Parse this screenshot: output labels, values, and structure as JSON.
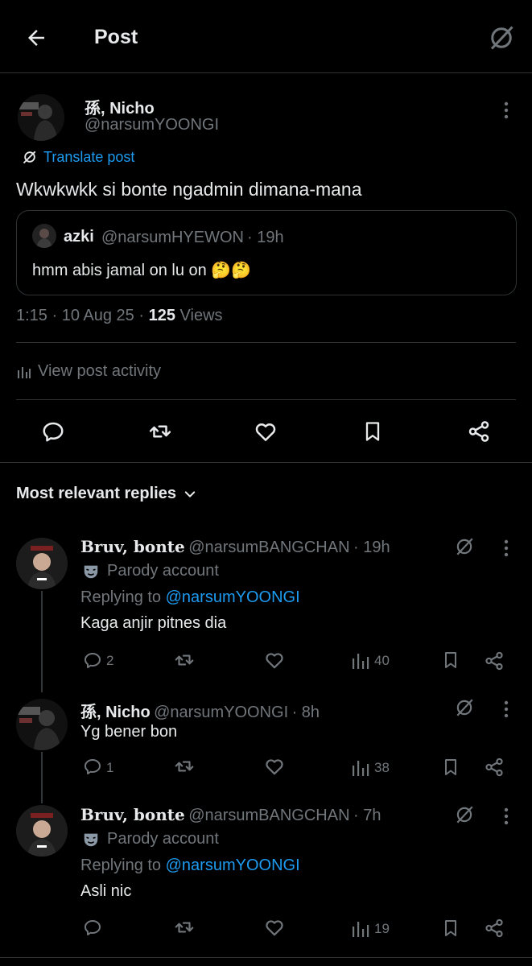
{
  "header": {
    "title": "Post"
  },
  "post": {
    "author_name": "孫, Nicho",
    "author_handle": "@narsumYOONGI",
    "translate_label": "Translate post",
    "text": "Wkwkwkk si bonte ngadmin dimana-mana",
    "quote": {
      "author_name": "azki",
      "author_handle": "@narsumHYEWON",
      "time": "· 19h",
      "text": "hmm abis jamal on lu on",
      "emoji": "🤔🤔"
    },
    "time": "1:15",
    "date": "· 10 Aug 25 ·",
    "views_count": "125",
    "views_label": "Views",
    "activity_label": "View post activity"
  },
  "sort": {
    "label": "Most relevant replies"
  },
  "replies": [
    {
      "name": "Bruv, bonte",
      "handle": "@narsumBANGCHAN",
      "time": "· 19h",
      "parody": "Parody account",
      "replying_prefix": "Replying to",
      "replying_handle": "@narsumYOONGI",
      "text": "Kaga anjir pitnes dia",
      "comments": "2",
      "views": "40"
    },
    {
      "name": "孫, Nicho",
      "handle": "@narsumYOONGI",
      "time": "· 8h",
      "text": "Yg bener bon",
      "comments": "1",
      "views": "38"
    },
    {
      "name": "Bruv, bonte",
      "handle": "@narsumBANGCHAN",
      "time": "· 7h",
      "parody": "Parody account",
      "replying_prefix": "Replying to",
      "replying_handle": "@narsumYOONGI",
      "text": "Asli nic",
      "views": "19"
    }
  ],
  "colors": {
    "background": "#000000",
    "text": "#e7e9ea",
    "secondary": "#71767b",
    "accent": "#1d9bf0",
    "divider": "#2f3336"
  }
}
